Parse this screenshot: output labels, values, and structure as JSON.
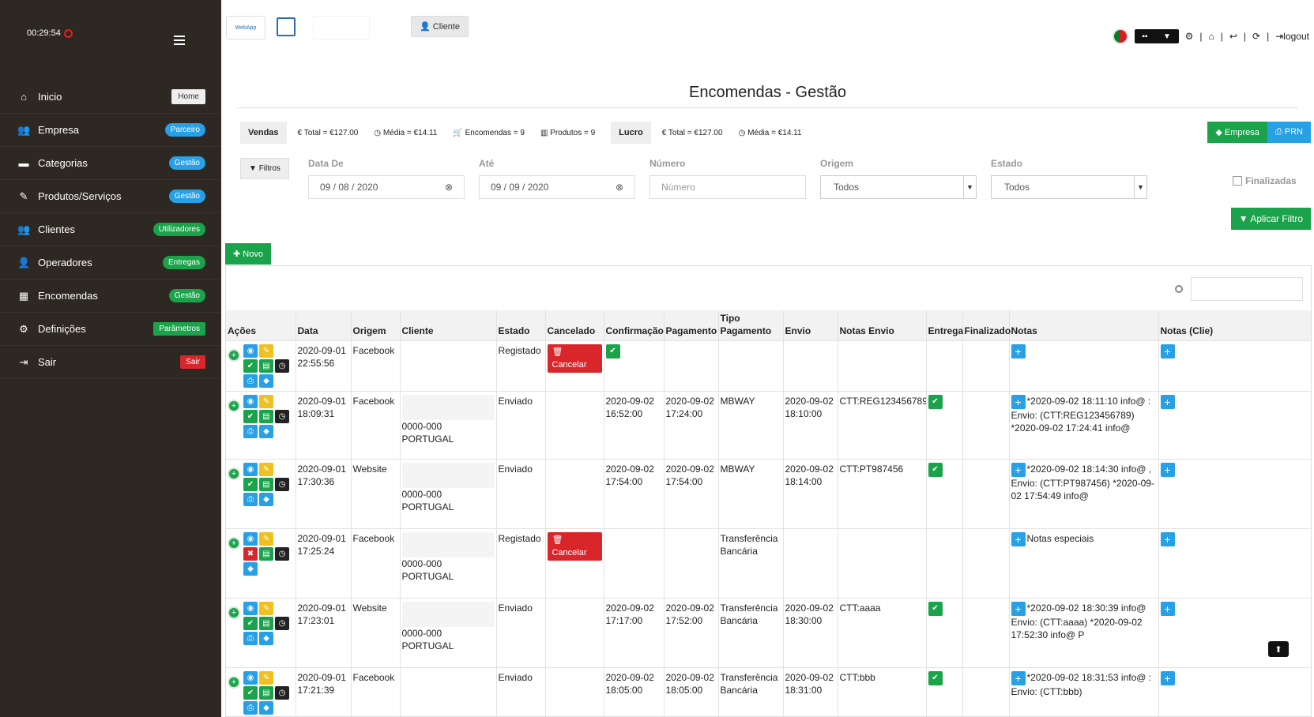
{
  "session": {
    "timer": "00:29:54"
  },
  "sidebar": {
    "items": [
      {
        "label": "Inicio",
        "badge": "Home",
        "icon": "home-icon"
      },
      {
        "label": "Empresa",
        "badge": "Parceiro",
        "icon": "users-icon"
      },
      {
        "label": "Categorias",
        "badge": "Gestão",
        "icon": "folder-icon"
      },
      {
        "label": "Produtos/Serviços",
        "badge": "Gestão",
        "icon": "tag-icon"
      },
      {
        "label": "Clientes",
        "badge": "Utilizadores",
        "icon": "users-icon"
      },
      {
        "label": "Operadores",
        "badge": "Entregas",
        "icon": "user-icon"
      },
      {
        "label": "Encomendas",
        "badge": "Gestão",
        "icon": "cart-icon"
      },
      {
        "label": "Definições",
        "badge": "Parâmetros",
        "icon": "gear-icon"
      },
      {
        "label": "Sair",
        "badge": "Sair",
        "icon": "logout-icon"
      }
    ]
  },
  "header": {
    "cliente_btn": "Cliente",
    "logout": "logout",
    "logo_text": "WebApp"
  },
  "page": {
    "title": "Encomendas - Gestão"
  },
  "stats": {
    "vendas_label": "Vendas",
    "vendas_total": "Total = €127.00",
    "vendas_media": "Média = €14.11",
    "encomendas": "Encomendas = 9",
    "produtos": "Produtos = 9",
    "lucro_label": "Lucro",
    "lucro_total": "Total = €127.00",
    "lucro_media": "Média = €14.11",
    "empresa_btn": "Empresa",
    "prn_btn": "PRN"
  },
  "filters": {
    "filtros_btn": "Filtros",
    "data_de_label": "Data De",
    "data_de_value": "09 / 08 / 2020",
    "ate_label": "Até",
    "ate_value": "09 / 09 / 2020",
    "numero_label": "Número",
    "numero_placeholder": "Número",
    "origem_label": "Origem",
    "origem_value": "Todos",
    "estado_label": "Estado",
    "estado_value": "Todos",
    "finalizadas_label": "Finalizadas",
    "aplicar_btn": "Aplicar Filtro"
  },
  "novo_btn": "Novo",
  "table": {
    "columns": [
      "Ações",
      "Data",
      "Origem",
      "Cliente",
      "Estado",
      "Cancelado",
      "Confirmação",
      "Pagamento",
      "Tipo Pagamento",
      "Envio",
      "Notas Envio",
      "Entrega",
      "Finalizado",
      "Notas",
      "Notas (Clie)"
    ],
    "cancel_label": "Cancelar",
    "rows": [
      {
        "date": "2020-09-01",
        "time": "22:55:56",
        "origem": "Facebook",
        "cliente": "",
        "estado": "Registado",
        "cancel": true,
        "confirm": "confirm-button",
        "pagamento": "",
        "tipo": "",
        "envio": "",
        "notas_envio": "",
        "entrega": false,
        "notas": "",
        "notas_clie": ""
      },
      {
        "date": "2020-09-01",
        "time": "18:09:31",
        "origem": "Facebook",
        "cliente": "0000-000 PORTUGAL",
        "estado": "Enviado",
        "cancel": false,
        "confirm": "2020-09-02 16:52:00",
        "pagamento": "2020-09-02 17:24:00",
        "tipo": "MBWAY",
        "envio": "2020-09-02 18:10:00",
        "notas_envio": "CTT:REG123456789",
        "entrega": true,
        "notas": "*2020-09-02 18:11:10 info@ : Envio: (CTT:REG123456789) *2020-09-02 17:24:41 info@",
        "notas_clie": ""
      },
      {
        "date": "2020-09-01",
        "time": "17:30:36",
        "origem": "Website",
        "cliente": "0000-000 PORTUGAL",
        "estado": "Enviado",
        "cancel": false,
        "confirm": "2020-09-02 17:54:00",
        "pagamento": "2020-09-02 17:54:00",
        "tipo": "MBWAY",
        "envio": "2020-09-02 18:14:00",
        "notas_envio": "CTT:PT987456",
        "entrega": true,
        "notas": "*2020-09-02 18:14:30 info@ , Envio: (CTT:PT987456) *2020-09-02 17:54:49 info@",
        "notas_clie": ""
      },
      {
        "date": "2020-09-01",
        "time": "17:25:24",
        "origem": "Facebook",
        "cliente": "0000-000 PORTUGAL",
        "estado": "Registado",
        "cancel": true,
        "confirm": "",
        "pagamento": "",
        "tipo": "Transferência Bancária",
        "envio": "",
        "notas_envio": "",
        "entrega": false,
        "notas": "Notas especiais",
        "notas_clie": ""
      },
      {
        "date": "2020-09-01",
        "time": "17:23:01",
        "origem": "Website",
        "cliente": "0000-000 PORTUGAL",
        "estado": "Enviado",
        "cancel": false,
        "confirm": "2020-09-02 17:17:00",
        "pagamento": "2020-09-02 17:52:00",
        "tipo": "Transferência Bancária",
        "envio": "2020-09-02 18:30:00",
        "notas_envio": "CTT:aaaa",
        "entrega": true,
        "notas": "*2020-09-02 18:30:39 info@ Envio: (CTT:aaaa) *2020-09-02 17:52:30 info@ P",
        "notas_clie": ""
      },
      {
        "date": "2020-09-01",
        "time": "17:21:39",
        "origem": "Facebook",
        "cliente": "",
        "estado": "Enviado",
        "cancel": false,
        "confirm": "2020-09-02 18:05:00",
        "pagamento": "2020-09-02 18:05:00",
        "tipo": "Transferência Bancária",
        "envio": "2020-09-02 18:31:00",
        "notas_envio": "CTT:bbb",
        "entrega": true,
        "notas": "*2020-09-02 18:31:53 info@ : Envio: (CTT:bbb)",
        "notas_clie": ""
      }
    ]
  },
  "colors": {
    "sidebar_bg": "#2e2823",
    "green": "#1aa34a",
    "blue": "#27a0e6",
    "red": "#d9262b",
    "yellow": "#f0c020"
  }
}
